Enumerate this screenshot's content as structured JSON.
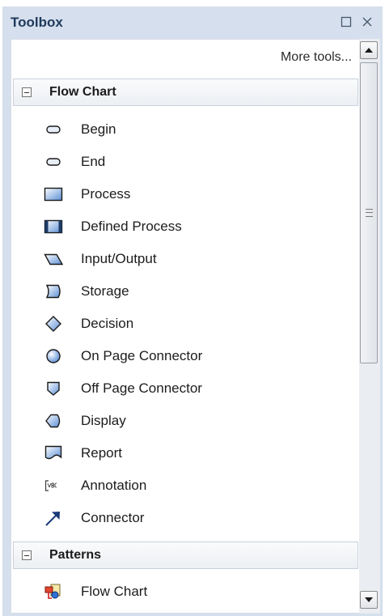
{
  "toolbox": {
    "title": "Toolbox",
    "more_tools": "More tools...",
    "sections": [
      {
        "label": "Flow Chart",
        "items": [
          {
            "label": "Begin",
            "icon": "begin-icon"
          },
          {
            "label": "End",
            "icon": "end-icon"
          },
          {
            "label": "Process",
            "icon": "process-icon"
          },
          {
            "label": "Defined Process",
            "icon": "defined-process-icon"
          },
          {
            "label": "Input/Output",
            "icon": "input-output-icon"
          },
          {
            "label": "Storage",
            "icon": "storage-icon"
          },
          {
            "label": "Decision",
            "icon": "decision-icon"
          },
          {
            "label": "On Page Connector",
            "icon": "on-page-connector-icon"
          },
          {
            "label": "Off Page Connector",
            "icon": "off-page-connector-icon"
          },
          {
            "label": "Display",
            "icon": "display-icon"
          },
          {
            "label": "Report",
            "icon": "report-icon"
          },
          {
            "label": "Annotation",
            "icon": "annotation-icon"
          },
          {
            "label": "Connector",
            "icon": "connector-arrow-icon"
          }
        ]
      },
      {
        "label": "Patterns",
        "items": [
          {
            "label": "Flow Chart",
            "icon": "flow-chart-pattern-icon"
          }
        ]
      }
    ]
  }
}
